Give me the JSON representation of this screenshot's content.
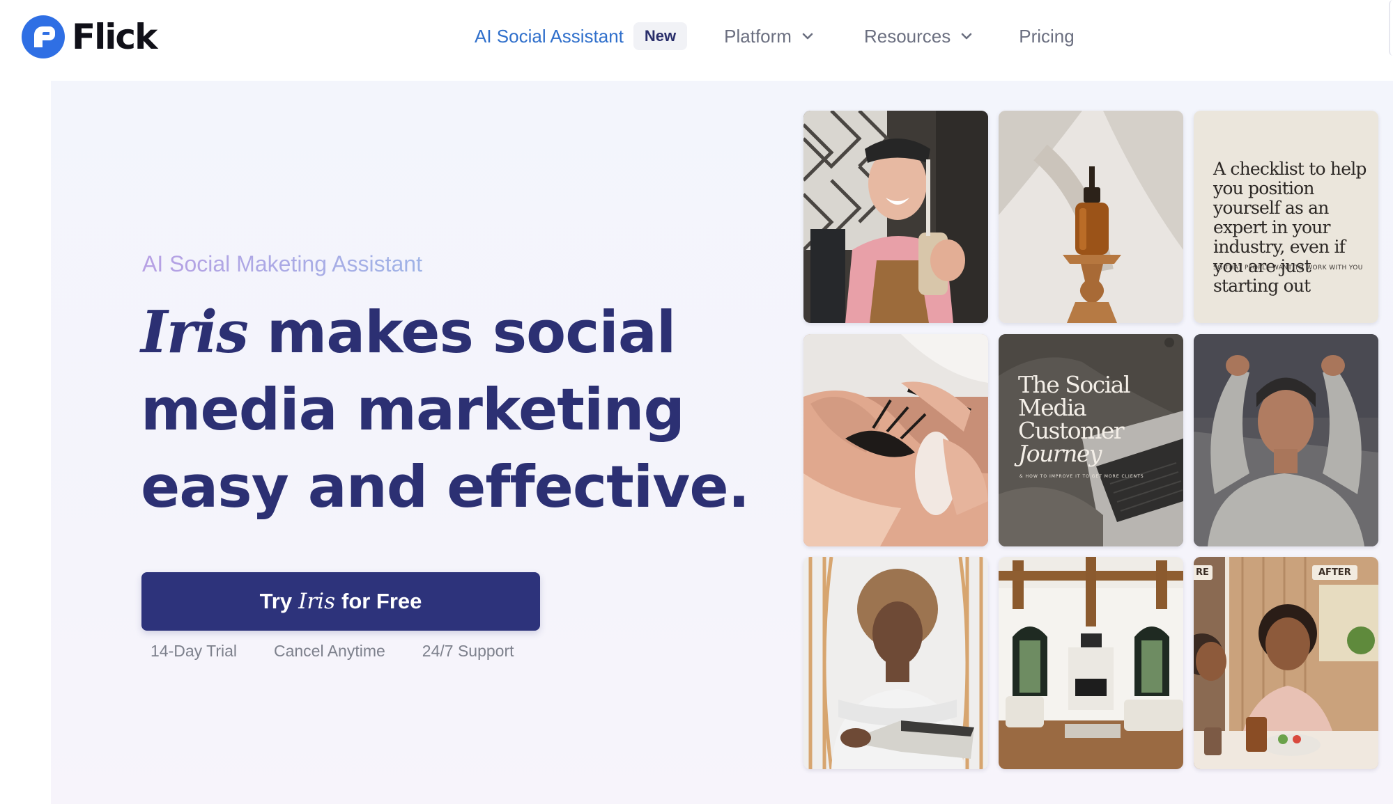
{
  "brand": {
    "name": "Flick"
  },
  "nav": {
    "ai_assistant": "AI Social Assistant",
    "new_badge": "New",
    "platform": "Platform",
    "resources": "Resources",
    "pricing": "Pricing"
  },
  "hero": {
    "eyebrow": "AI Social Maketing Assistant",
    "headline_italic": "Iris",
    "headline_rest": " makes social media marketing easy and effective.",
    "cta_prefix": "Try",
    "cta_italic": "Iris",
    "cta_suffix": "for Free",
    "perks": [
      "14-Day Trial",
      "Cancel Anytime",
      "24/7 Support"
    ]
  },
  "gallery": {
    "tiles": [
      {
        "name": "barista-photo"
      },
      {
        "name": "serum-bottle-photo"
      },
      {
        "name": "checklist-graphic",
        "text": "A checklist to help you position yourself as an expert in your industry, even if you are just starting out",
        "subtext": "SO THAT PEOPLE WANT TO WORK WITH YOU"
      },
      {
        "name": "lash-extension-photo"
      },
      {
        "name": "customer-journey-graphic",
        "line1": "The Social",
        "line2": "Media",
        "line3": "Customer",
        "line4": "Journey",
        "subtext": "& HOW TO IMPROVE IT TO GET MORE CLIENTS"
      },
      {
        "name": "man-stretching-photo"
      },
      {
        "name": "woman-reading-photo"
      },
      {
        "name": "interior-living-room-photo"
      },
      {
        "name": "before-after-illustration",
        "before_tag": "RE",
        "after_tag": "AFTER"
      }
    ]
  },
  "colors": {
    "primary": "#2d337b",
    "nav_active": "#2f6fcb",
    "headline": "#2c3073",
    "hero_bg": "#f3f5fc"
  },
  "icons": {
    "logo": "flick-logo-icon",
    "dropdown": "chevron-down-icon"
  }
}
